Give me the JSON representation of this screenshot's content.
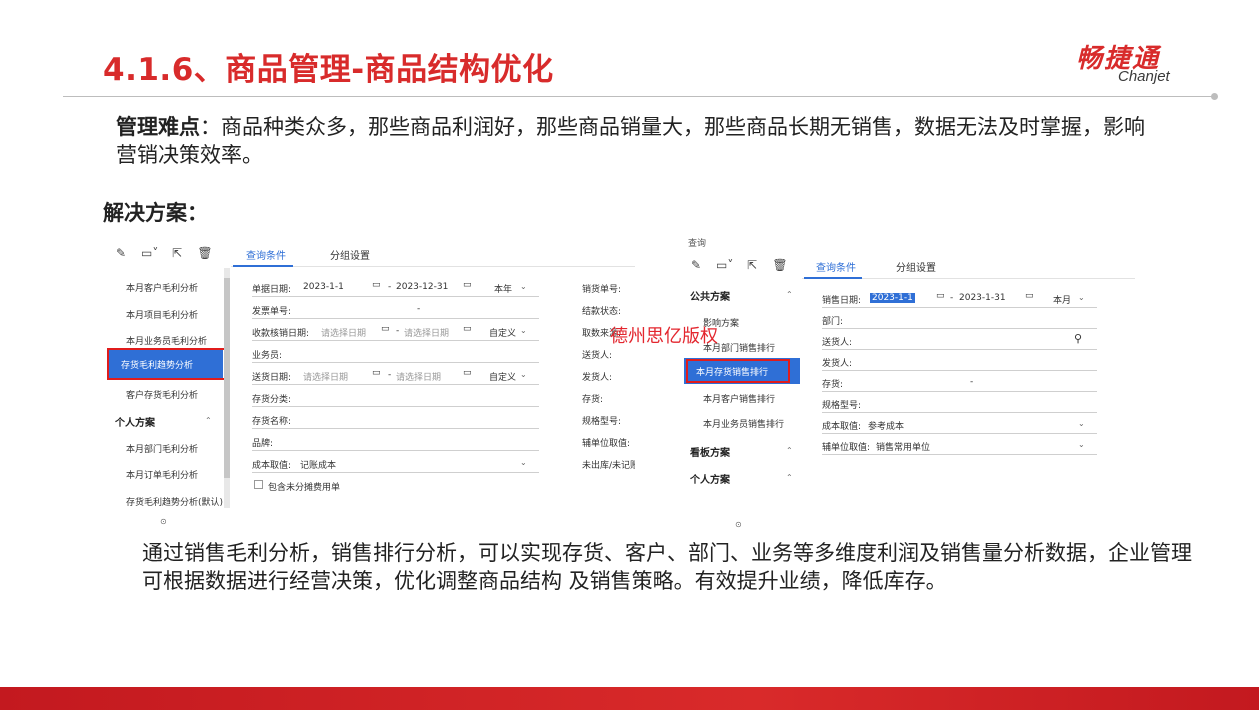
{
  "slide": {
    "title": "4.1.6、商品管理-商品结构优化",
    "brand_cn": "畅捷通",
    "brand_en": "Chanjet",
    "pain_label": "管理难点",
    "pain_text": "：商品种类众多，那些商品利润好，那些商品销量大，那些商品长期无销售，数据无法及时掌握，影响营销决策效率。",
    "solution_label": "解决方案：",
    "description": "通过销售毛利分析，销售排行分析，可以实现存货、客户、部门、业务等多维度利润及销售量分析数据，企业管理可根据数据进行经营决策，优化调整商品结构 及销售策略。有效提升业绩，降低库存。",
    "watermark": "德州思亿版权",
    "accent_color": "#d82b2b",
    "highlight_color": "#2f6fd6"
  },
  "left_panel": {
    "toolbar_icons": [
      "edit-icon",
      "save-icon",
      "export-icon",
      "delete-icon"
    ],
    "sidebar_items": [
      "本月客户毛利分析",
      "本月项目毛利分析",
      "本月业务员毛利分析",
      "存货毛利趋势分析",
      "客户存货毛利分析"
    ],
    "selected_item": "存货毛利趋势分析",
    "personal_head": "个人方案",
    "personal_items": [
      "本月部门毛利分析",
      "本月订单毛利分析",
      "存货毛利趋势分析(默认)"
    ],
    "tabs": [
      "查询条件",
      "分组设置"
    ],
    "fields": {
      "doc_date_label": "单据日期:",
      "doc_date_from": "2023-1-1",
      "doc_date_sep": "-",
      "doc_date_to": "2023-12-31",
      "doc_date_period": "本年",
      "invoice_no_label": "发票单号:",
      "invoice_no_sep": "-",
      "collect_date_label": "收款核销日期:",
      "collect_date_from": "请选择日期",
      "collect_date_sep": "-",
      "collect_date_to": "请选择日期",
      "collect_date_period": "自定义",
      "salesman_label": "业务员:",
      "delivery_date_label": "送货日期:",
      "delivery_date_from": "请选择日期",
      "delivery_date_sep": "-",
      "delivery_date_to": "请选择日期",
      "delivery_date_period": "自定义",
      "inventory_class_label": "存货分类:",
      "inventory_name_label": "存货名称:",
      "brand_label": "品牌:",
      "cost_label": "成本取值:",
      "cost_value": "记账成本",
      "include_label": "包含未分摊费用单",
      "right_col": [
        "销货单号:",
        "结款状态:",
        "取数来源:",
        "送货人:",
        "发货人:",
        "存货:",
        "规格型号:",
        "辅单位取值:",
        "未出库/未记账"
      ]
    }
  },
  "right_panel": {
    "header_partial": "查询",
    "toolbar_icons": [
      "edit-icon",
      "save-icon",
      "export-icon",
      "delete-icon"
    ],
    "public_head": "公共方案",
    "public_items": [
      "影响方案",
      "本月部门销售排行",
      "本月存货销售排行",
      "本月客户销售排行",
      "本月业务员销售排行"
    ],
    "selected_item": "本月存货销售排行",
    "board_head": "看板方案",
    "personal_head": "个人方案",
    "tabs": [
      "查询条件",
      "分组设置"
    ],
    "fields": {
      "sales_date_label": "销售日期:",
      "sales_date_from": "2023-1-1",
      "sales_date_sep": "-",
      "sales_date_to": "2023-1-31",
      "sales_date_period": "本月",
      "dept_label": "部门:",
      "deliverer_label": "送货人:",
      "shipper_label": "发货人:",
      "inventory_label": "存货:",
      "inventory_sep": "-",
      "spec_label": "规格型号:",
      "cost_label": "成本取值:",
      "cost_value": "参考成本",
      "aux_label": "辅单位取值:",
      "aux_value": "销售常用单位"
    }
  }
}
